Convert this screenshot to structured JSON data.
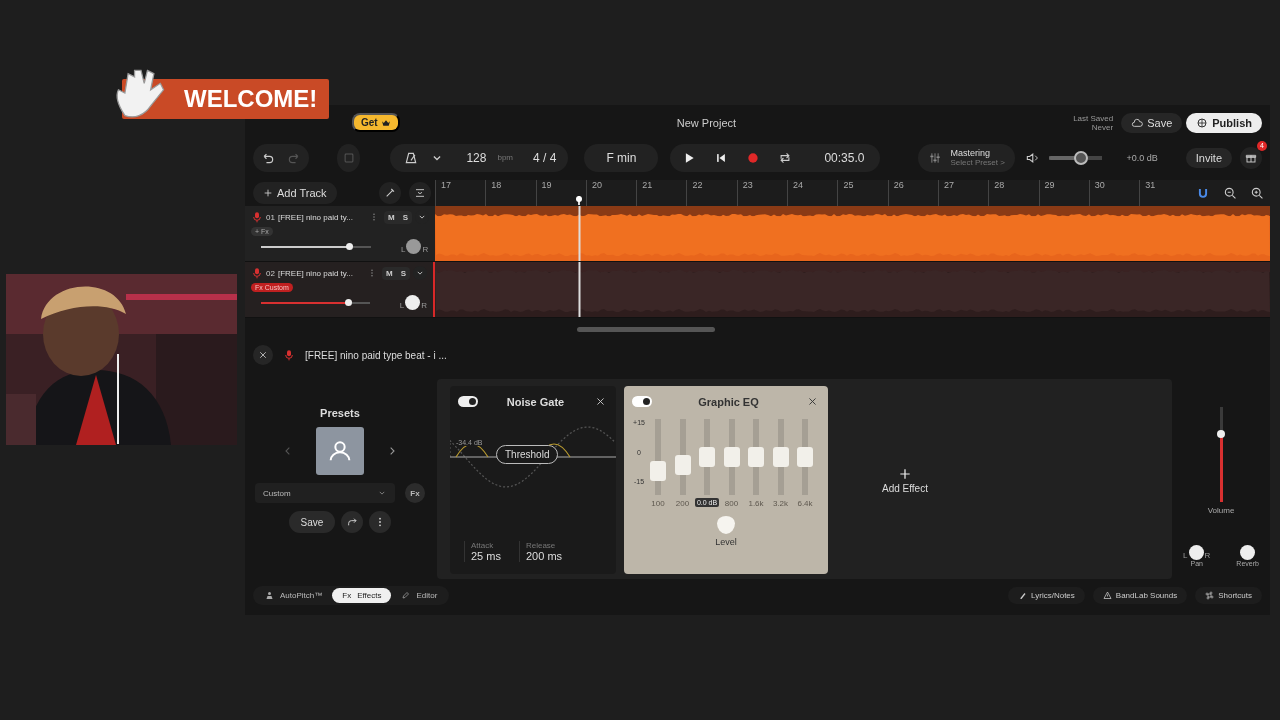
{
  "overlay": {
    "banner": "WELCOME!"
  },
  "header": {
    "get_badge": "Get",
    "title": "New Project",
    "last_saved_label": "Last Saved",
    "last_saved_value": "Never",
    "save": "Save",
    "publish": "Publish"
  },
  "toolbar": {
    "tempo": "128",
    "tempo_unit": "bpm",
    "time_signature": "4 / 4",
    "key": "F min",
    "time": "00:35.0",
    "mastering_title": "Mastering",
    "mastering_preset": "Select Preset >",
    "master_volume": {
      "level": 0.6
    },
    "master_reading": "+0.0 dB",
    "invite": "Invite",
    "notifications": "4"
  },
  "add_track": "Add Track",
  "ruler": [
    "17",
    "18",
    "19",
    "20",
    "21",
    "22",
    "23",
    "24",
    "25",
    "26",
    "27",
    "28",
    "29",
    "30",
    "31"
  ],
  "playhead": {
    "level": 0.173
  },
  "tracks": [
    {
      "number": "01",
      "name": "[FREE] nino paid ty...",
      "mute": "M",
      "solo": "S",
      "fx": "+ Fx",
      "fx_active": false,
      "selected": false,
      "volume": {
        "level": 0.8
      },
      "pan_left": "L",
      "pan_right": "R"
    },
    {
      "number": "02",
      "name": "[FREE] nino paid ty...",
      "mute": "M",
      "solo": "S",
      "fx": "Fx Custom",
      "fx_active": true,
      "selected": true,
      "volume": {
        "level": 0.8
      },
      "pan_left": "L",
      "pan_right": "R"
    }
  ],
  "selected_track": {
    "name": "[FREE] nino paid type beat - i ..."
  },
  "presets": {
    "title": "Presets",
    "preset": "Custom",
    "fx_button": "Fx",
    "save": "Save"
  },
  "effects": [
    {
      "kind": "noise_gate",
      "name": "Noise Gate",
      "on": true,
      "threshold_reading": "-34.4 dB",
      "threshold_button": "Threshold",
      "params": [
        {
          "label": "Attack",
          "value": "25 ms"
        },
        {
          "label": "Release",
          "value": "200 ms"
        }
      ]
    },
    {
      "kind": "graphic_eq",
      "name": "Graphic EQ",
      "on": true,
      "scale": [
        "+15",
        "0",
        "-15"
      ],
      "bands": [
        {
          "label": "100",
          "level": 0.25
        },
        {
          "label": "200",
          "level": 0.35
        },
        {
          "tooltip": "0.0 dB",
          "level": 0.5
        },
        {
          "label": "800",
          "level": 0.5
        },
        {
          "label": "1.6k",
          "level": 0.5
        },
        {
          "label": "3.2k",
          "level": 0.5
        },
        {
          "label": "6.4k",
          "level": 0.5
        }
      ],
      "level_label": "Level"
    }
  ],
  "add_effect": "Add Effect",
  "channel": {
    "volume": {
      "level": 0.72
    },
    "volume_label": "Volume",
    "pan_left": "L",
    "pan_right": "R",
    "pan_label": "Pan",
    "reverb_label": "Reverb"
  },
  "modes": [
    {
      "label": "AutoPitch™",
      "selected": false
    },
    {
      "label": "Effects",
      "prefix": "Fx",
      "selected": true
    },
    {
      "label": "Editor",
      "selected": false
    }
  ],
  "links": [
    "Lyrics/Notes",
    "BandLab Sounds",
    "Shortcuts"
  ]
}
